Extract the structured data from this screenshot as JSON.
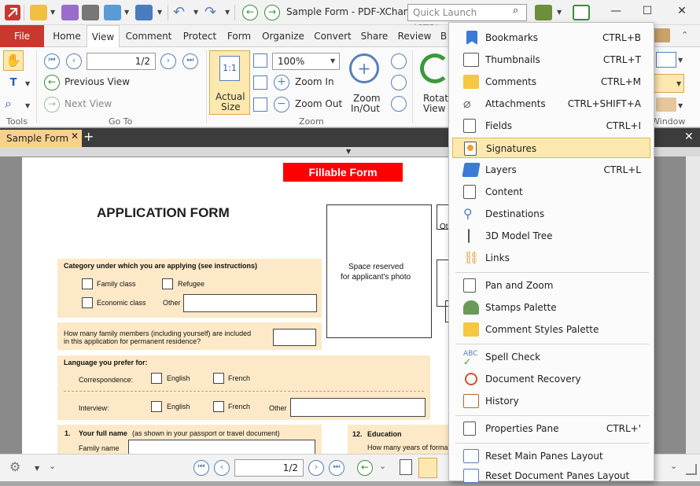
{
  "titlebar": {
    "title": "Sample Form - PDF-XChan...",
    "search_placeholder": "Quick Launch (CTRL+.)"
  },
  "ribbon_tabs": {
    "file": "File",
    "items": [
      "Home",
      "View",
      "Comment",
      "Protect",
      "Form",
      "Organize",
      "Convert",
      "Share",
      "Review",
      "B"
    ]
  },
  "ribbon": {
    "tools_label": "Tools",
    "goto": {
      "page_value": "1/2",
      "previous_view": "Previous View",
      "next_view": "Next View",
      "label": "Go To"
    },
    "zoom": {
      "actual_size_l1": "Actual",
      "actual_size_l2": "Size",
      "zoom_value": "100%",
      "zoom_in": "Zoom In",
      "zoom_out": "Zoom Out",
      "zoom_inout_l1": "Zoom",
      "zoom_inout_l2": "In/Out",
      "label": "Zoom"
    },
    "rotate_l1": "Rotate",
    "rotate_l2": "View",
    "window_label": "Window"
  },
  "doc_tab": {
    "name": "Sample Form"
  },
  "form": {
    "banner": "Fillable Form",
    "title": "APPLICATION FORM",
    "photo_l1": "Space reserved",
    "photo_l2": "for applicant's photo",
    "category_heading": "Category under which you are applying (see instructions)",
    "family_class": "Family class",
    "refugee": "Refugee",
    "economic_class": "Economic class",
    "other": "Other",
    "family_q_l1": "How many family members (including yourself) are included",
    "family_q_l2": "in this application for permanent residence?",
    "language_heading": "Language you prefer for:",
    "correspondence": "Correspondence:",
    "interview": "Interview:",
    "english": "English",
    "french": "French",
    "other2": "Other",
    "q1_num": "1.",
    "q1_label": "Your full name",
    "q1_sub": "(as shown in your passport or travel document)",
    "family_name": "Family name",
    "q12_num": "12.",
    "q12_label": "Education",
    "q12_sub": "How many years of forma",
    "partial_ot": "Ot"
  },
  "statusbar": {
    "page_value": "1/2"
  },
  "menu": {
    "items": [
      {
        "label": "Bookmarks",
        "shortcut": "CTRL+B",
        "icon": "bookmark-icon"
      },
      {
        "label": "Thumbnails",
        "shortcut": "CTRL+T",
        "icon": "thumbnails-icon"
      },
      {
        "label": "Comments",
        "shortcut": "CTRL+M",
        "icon": "comments-icon"
      },
      {
        "label": "Attachments",
        "shortcut": "CTRL+SHIFT+A",
        "icon": "paperclip-icon"
      },
      {
        "label": "Fields",
        "shortcut": "CTRL+I",
        "icon": "fields-icon"
      },
      {
        "label": "Signatures",
        "shortcut": "",
        "icon": "signature-icon"
      },
      {
        "label": "Layers",
        "shortcut": "CTRL+L",
        "icon": "layers-icon"
      },
      {
        "label": "Content",
        "shortcut": "",
        "icon": "content-icon"
      },
      {
        "label": "Destinations",
        "shortcut": "",
        "icon": "destination-icon"
      },
      {
        "label": "3D Model Tree",
        "shortcut": "",
        "icon": "model-tree-icon"
      },
      {
        "label": "Links",
        "shortcut": "",
        "icon": "link-icon"
      },
      {
        "label": "Pan and Zoom",
        "shortcut": "",
        "icon": "pan-zoom-icon"
      },
      {
        "label": "Stamps Palette",
        "shortcut": "",
        "icon": "stamp-icon"
      },
      {
        "label": "Comment Styles Palette",
        "shortcut": "",
        "icon": "comment-styles-icon"
      },
      {
        "label": "Spell Check",
        "shortcut": "",
        "icon": "spell-check-icon"
      },
      {
        "label": "Document Recovery",
        "shortcut": "",
        "icon": "recovery-icon"
      },
      {
        "label": "History",
        "shortcut": "",
        "icon": "history-icon"
      },
      {
        "label": "Properties Pane",
        "shortcut": "CTRL+'",
        "icon": "properties-icon"
      },
      {
        "label": "Reset Main Panes Layout",
        "shortcut": "",
        "icon": "reset-layout-icon"
      },
      {
        "label": "Reset Document Panes Layout",
        "shortcut": "",
        "icon": "reset-doc-layout-icon"
      }
    ],
    "highlighted_index": 5
  },
  "colors": {
    "file_tab": "#c8382e",
    "banner_red": "#ff0000",
    "form_fill": "#fde9c7",
    "highlight": "#fde9b0",
    "doc_tab": "#f8d28a"
  }
}
